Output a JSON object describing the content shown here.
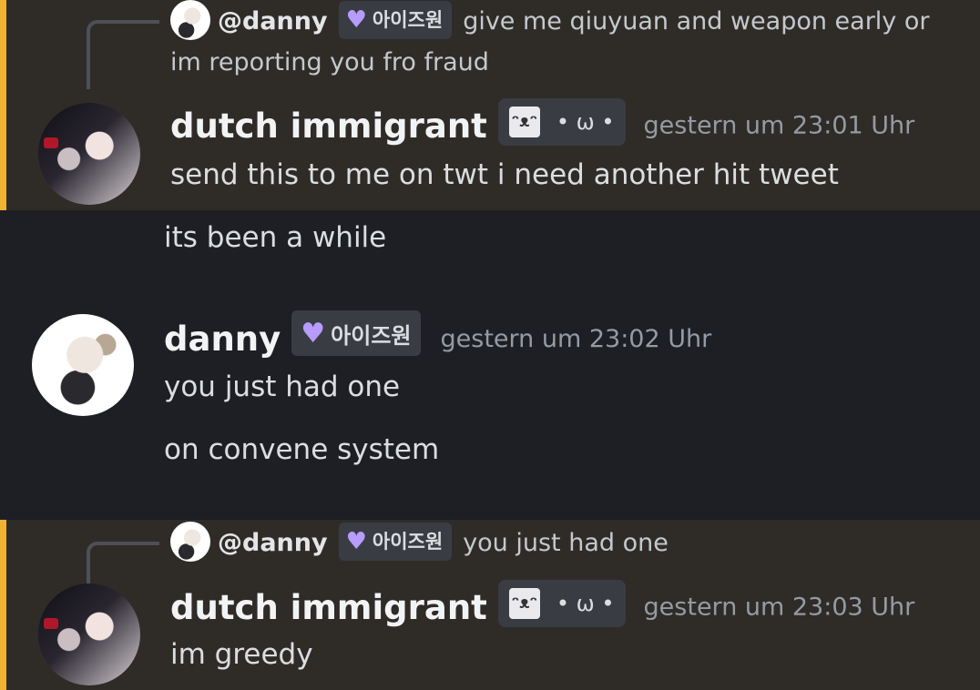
{
  "messages": [
    {
      "reply": {
        "mention": "@danny",
        "role_tag": "아이즈원",
        "text": "give me qiuyuan and weapon early or im reporting you fro fraud"
      },
      "author": "dutch immigrant",
      "author_tag": "• ω •",
      "timestamp": "gestern um 23:01 Uhr",
      "lines": [
        "send this to me on twt i need another hit tweet"
      ]
    },
    {
      "lines": [
        "its been a while"
      ]
    },
    {
      "author": "danny",
      "author_tag": "아이즈원",
      "timestamp": "gestern um 23:02 Uhr",
      "lines": [
        "you just had one",
        "on convene system"
      ]
    },
    {
      "reply": {
        "mention": "@danny",
        "role_tag": "아이즈원",
        "text": "you just had one"
      },
      "author": "dutch immigrant",
      "author_tag": "• ω •",
      "timestamp": "gestern um 23:03 Uhr",
      "lines": [
        "im greedy"
      ]
    }
  ],
  "colors": {
    "mention_highlight_bg": "#2f2c28",
    "mention_bar": "#f0b232",
    "channel_bg": "#1e1f24",
    "heart": "#b69cff",
    "timestamp": "#949ba4"
  },
  "icons": {
    "role_icon": "purple-heart-icon",
    "author_icon": "pixel-cat-icon"
  }
}
